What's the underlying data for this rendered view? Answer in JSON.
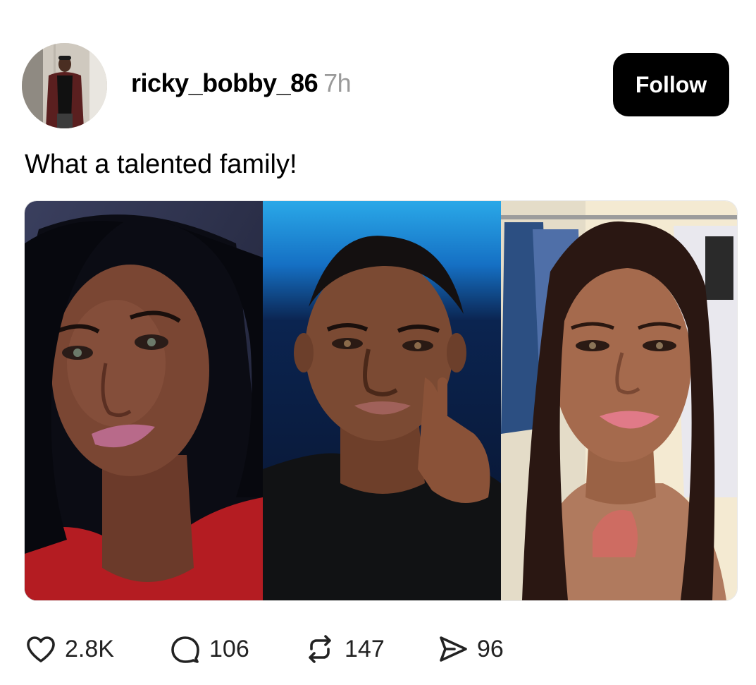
{
  "post": {
    "username": "ricky_bobby_86",
    "timestamp": "7h",
    "follow_label": "Follow",
    "caption": "What a talented family!"
  },
  "media": {
    "photos": [
      {
        "subject": "woman with long dark hair in red top"
      },
      {
        "subject": "man in black t-shirt with hand on chin"
      },
      {
        "subject": "woman with long dark hair and chest tattoo"
      }
    ]
  },
  "actions": {
    "likes": "2.8K",
    "replies": "106",
    "reposts": "147",
    "shares": "96"
  },
  "icons": {
    "like": "heart-icon",
    "reply": "comment-bubble-icon",
    "repost": "repost-icon",
    "share": "send-icon"
  }
}
